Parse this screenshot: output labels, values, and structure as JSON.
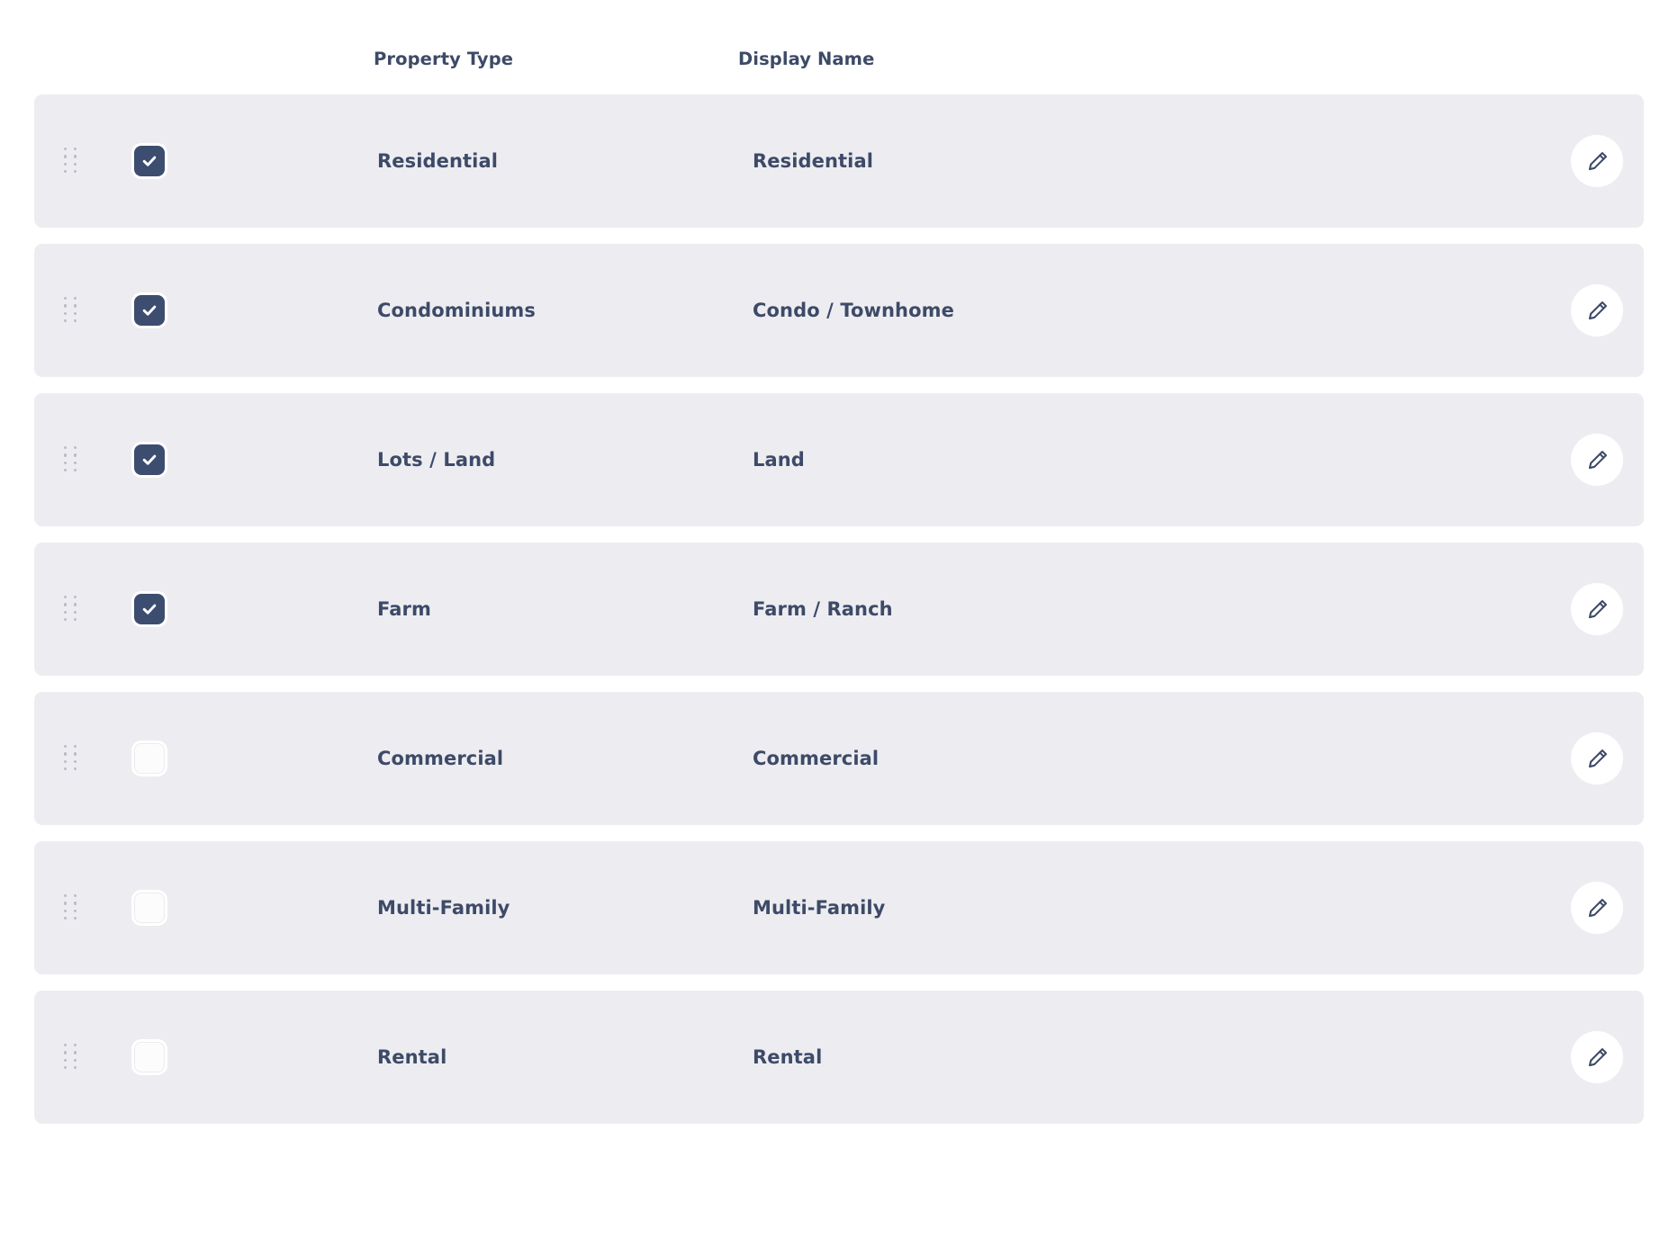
{
  "table": {
    "headers": {
      "property_type": "Property Type",
      "display_name": "Display Name"
    },
    "colors": {
      "row_background": "#ededf1",
      "page_background": "#ffffff",
      "text": "#3d4a68",
      "checkbox_checked": "#3d4d70",
      "checkbox_unchecked": "#fcfcfd",
      "drag_handle_dot": "#b9bcca",
      "edit_button_background": "#ffffff",
      "edit_icon": "#3d4a68"
    },
    "icons": {
      "drag_handle": "drag-handle-icon",
      "checkbox_check": "check-icon",
      "edit": "pencil-icon"
    },
    "rows": [
      {
        "property_type": "Residential",
        "display_name": "Residential",
        "checked": true,
        "edit_label": "Edit"
      },
      {
        "property_type": "Condominiums",
        "display_name": "Condo / Townhome",
        "checked": true,
        "edit_label": "Edit"
      },
      {
        "property_type": "Lots / Land",
        "display_name": "Land",
        "checked": true,
        "edit_label": "Edit"
      },
      {
        "property_type": "Farm",
        "display_name": "Farm / Ranch",
        "checked": true,
        "edit_label": "Edit"
      },
      {
        "property_type": "Commercial",
        "display_name": "Commercial",
        "checked": false,
        "edit_label": "Edit"
      },
      {
        "property_type": "Multi-Family",
        "display_name": "Multi-Family",
        "checked": false,
        "edit_label": "Edit"
      },
      {
        "property_type": "Rental",
        "display_name": "Rental",
        "checked": false,
        "edit_label": "Edit"
      }
    ]
  }
}
